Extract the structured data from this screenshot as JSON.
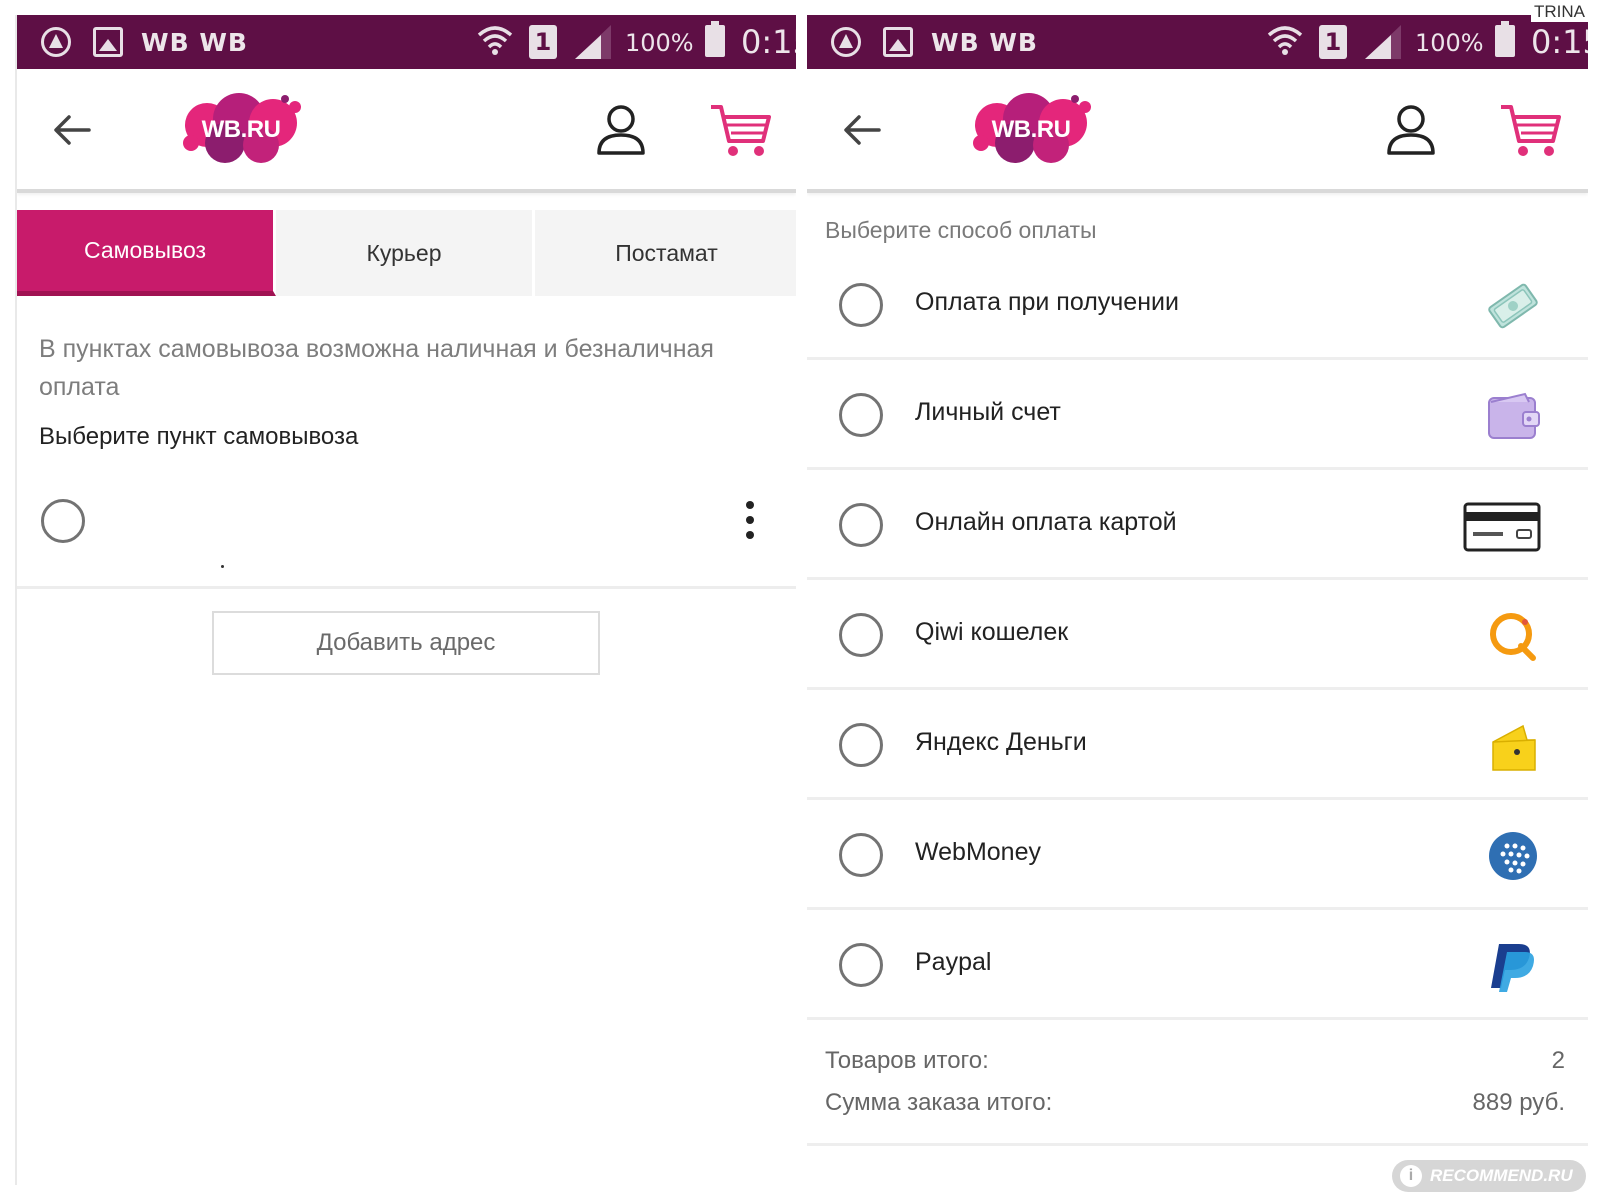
{
  "status_bar": {
    "apps": "WB  WB",
    "sim": "1",
    "battery": "100%",
    "time": "0:15"
  },
  "header": {
    "logo_text": "WB.RU"
  },
  "left": {
    "tabs": [
      {
        "label": "Самовывоз",
        "active": true
      },
      {
        "label": "Курьер",
        "active": false
      },
      {
        "label": "Постамат",
        "active": false
      }
    ],
    "info_text": "В пунктах самовывоза возможна наличная и безналичная оплата",
    "choose_point": "Выберите пункт самовывоза",
    "add_address": "Добавить адрес"
  },
  "right": {
    "heading": "Выберите способ оплаты",
    "methods": [
      {
        "label": "Оплата при получении",
        "icon": "cash-icon"
      },
      {
        "label": "Личный счет",
        "icon": "wallet-icon"
      },
      {
        "label": "Онлайн оплата картой",
        "icon": "credit-card-icon"
      },
      {
        "label": "Qiwi кошелек",
        "icon": "qiwi-icon"
      },
      {
        "label": "Яндекс Деньги",
        "icon": "yandex-money-icon"
      },
      {
        "label": "WebMoney",
        "icon": "webmoney-icon"
      },
      {
        "label": "Paypal",
        "icon": "paypal-icon"
      }
    ],
    "summary": {
      "items_label": "Товаров итого:",
      "items_value": "2",
      "total_label": "Сумма заказа итого:",
      "total_value": "889 руб."
    }
  },
  "watermarks": {
    "top": "TRINA",
    "bottom": "RECOMMEND.RU"
  },
  "colors": {
    "status_bar": "#5e0f45",
    "accent": "#c81b6b",
    "cart": "#e0307a"
  }
}
